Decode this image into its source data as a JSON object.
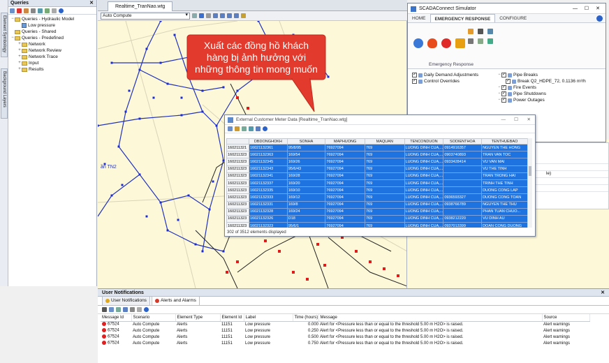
{
  "side_tabs": [
    "Element Symbology",
    "Background Layers"
  ],
  "queries_panel": {
    "title": "Queries",
    "tree": [
      {
        "label": "Queries - Hydraulic Model",
        "level": 0,
        "expander": "−",
        "icon": "folder"
      },
      {
        "label": "Low pressure",
        "level": 1,
        "expander": "",
        "icon": "query"
      },
      {
        "label": "Queries - Shared",
        "level": 0,
        "expander": "",
        "icon": "folder"
      },
      {
        "label": "Queries - Predefined",
        "level": 0,
        "expander": "−",
        "icon": "folder"
      },
      {
        "label": "Network",
        "level": 1,
        "expander": "+",
        "icon": "folder"
      },
      {
        "label": "Network Review",
        "level": 1,
        "expander": "+",
        "icon": "folder"
      },
      {
        "label": "Network Trace",
        "level": 1,
        "expander": "+",
        "icon": "folder"
      },
      {
        "label": "Input",
        "level": 1,
        "expander": "+",
        "icon": "folder"
      },
      {
        "label": "Results",
        "level": 1,
        "expander": "+",
        "icon": "folder"
      }
    ]
  },
  "map_doc": {
    "tab_label": "Realtime_TranNao.wtg",
    "scenario": "Auto Compute",
    "map_label": "ần TN2"
  },
  "callout": {
    "lines": [
      "Xuất các đồng hồ khách",
      "hàng bị ảnh hưởng với",
      "những thông tin mong muốn"
    ],
    "color": "#e23a2c"
  },
  "scada": {
    "title": "SCADAConnect Simulator",
    "tabs": [
      "HOME",
      "EMERGENCY RESPONSE",
      "CONFIGURE"
    ],
    "active_tab": "EMERGENCY RESPONSE",
    "group_label": "Emergency Response",
    "left_items": [
      "Daily Demand Adjustments",
      "Control Overrides"
    ],
    "right_items": [
      {
        "label": "Pipe Breaks",
        "level": 0
      },
      {
        "label": "Break Q2_HDPE_72, 0.1136 m³/h",
        "level": 1
      },
      {
        "label": "Fire Events",
        "level": 0
      },
      {
        "label": "Pipe Shutdowns",
        "level": 0
      },
      {
        "label": "Power Outages",
        "level": 0
      }
    ],
    "lower_fragment": "le)"
  },
  "external_data": {
    "title": "External Customer Meter Data [Realtime_TranNao.wtg]",
    "columns": [
      "DBDONGHOKH",
      "SONHA",
      "MAPHUONG",
      "MAQUAN",
      "TENCONDUON",
      "SODIENTHOA",
      "TENTHUEBAO"
    ],
    "rows": [
      {
        "id": "160211321",
        "c": [
          "16021132361",
          "95/8/95",
          "76927094",
          "769",
          "LUONG DINH CUA,...",
          "0914916357",
          "NGUYEN THE HONG"
        ]
      },
      {
        "id": "160211323",
        "c": [
          "16021132363",
          "169/54",
          "76927094",
          "769",
          "LUONG DINH CUA,...",
          "0903740893",
          "TRAN VAN TOC"
        ]
      },
      {
        "id": "160211323",
        "c": [
          "16021132345",
          "169/26",
          "76927094",
          "769",
          "LUONG DINH CUA,...",
          "0933428414",
          "VU VAN MAI"
        ]
      },
      {
        "id": "160211323",
        "c": [
          "16021132343",
          "95/6/43",
          "76927094",
          "769",
          "LUONG DINH CUA,...",
          "",
          "VU THE TINH"
        ]
      },
      {
        "id": "160211323",
        "c": [
          "16021132341",
          "169/28",
          "76927094",
          "769",
          "LUONG DINH CUA,...",
          "",
          "TRAN TRONG HAI"
        ]
      },
      {
        "id": "160211323",
        "c": [
          "16021132337",
          "169/20",
          "76927094",
          "769",
          "LUONG DINH CUA,...",
          "",
          "TRINH THE TINH"
        ]
      },
      {
        "id": "160211323",
        "c": [
          "16021132335",
          "169/10",
          "76927094",
          "769",
          "LUONG DINH CUA,...",
          "",
          "DUONG CONG LAP"
        ]
      },
      {
        "id": "160211323",
        "c": [
          "16021132333",
          "169/12",
          "76927094",
          "769",
          "LUONG DINH CUA,...",
          "0936593327",
          "DUONG CONG TOAN"
        ]
      },
      {
        "id": "160211323",
        "c": [
          "16021132331",
          "169/8",
          "76927094",
          "769",
          "LUONG DINH CUA,...",
          "0938766789",
          "NGUYEN THE THU"
        ]
      },
      {
        "id": "160211323",
        "c": [
          "16021132328",
          "169/24",
          "76927094",
          "769",
          "LUONG DINH CUA,...",
          "",
          "PHAN TUAN CHUO..."
        ]
      },
      {
        "id": "160211323",
        "c": [
          "16021132326",
          "D18",
          "76927094",
          "769",
          "LUONG DINH CUA,...",
          "0938212220",
          "VU DINH AU"
        ]
      },
      {
        "id": "160211323",
        "c": [
          "16021132323",
          "95/6/1",
          "76927094",
          "769",
          "LUONG DINH CUA,...",
          "0937013399",
          "DOAN CONG DUONG"
        ]
      }
    ],
    "status": "302 of 3512 elements displayed"
  },
  "notifications": {
    "title": "User Notifications",
    "tabs": [
      "User Notifications",
      "Alerts and Alarms"
    ],
    "active_tab": "Alerts and Alarms",
    "columns": [
      "Message Id",
      "Scenario",
      "Element Type",
      "Element Id",
      "Label",
      "Time (hours)",
      "Message",
      "Source"
    ],
    "rows": [
      [
        "67524",
        "Auto Compute",
        "Alerts",
        "11151",
        "Low pressure",
        "0.000",
        "Alert for <Pressure less than or equal to the threshold 5.00 m H2O> is raised.",
        "Alert warnings"
      ],
      [
        "67524",
        "Auto Compute",
        "Alerts",
        "11151",
        "Low pressure",
        "0.250",
        "Alert for <Pressure less than or equal to the threshold 5.00 m H2O> is raised.",
        "Alert warnings"
      ],
      [
        "67524",
        "Auto Compute",
        "Alerts",
        "11151",
        "Low pressure",
        "0.500",
        "Alert for <Pressure less than or equal to the threshold 5.00 m H2O> is raised.",
        "Alert warnings"
      ],
      [
        "67524",
        "Auto Compute",
        "Alerts",
        "11151",
        "Low pressure",
        "0.750",
        "Alert for <Pressure less than or equal to the threshold 5.00 m H2O> is raised.",
        "Alert warnings"
      ]
    ]
  }
}
